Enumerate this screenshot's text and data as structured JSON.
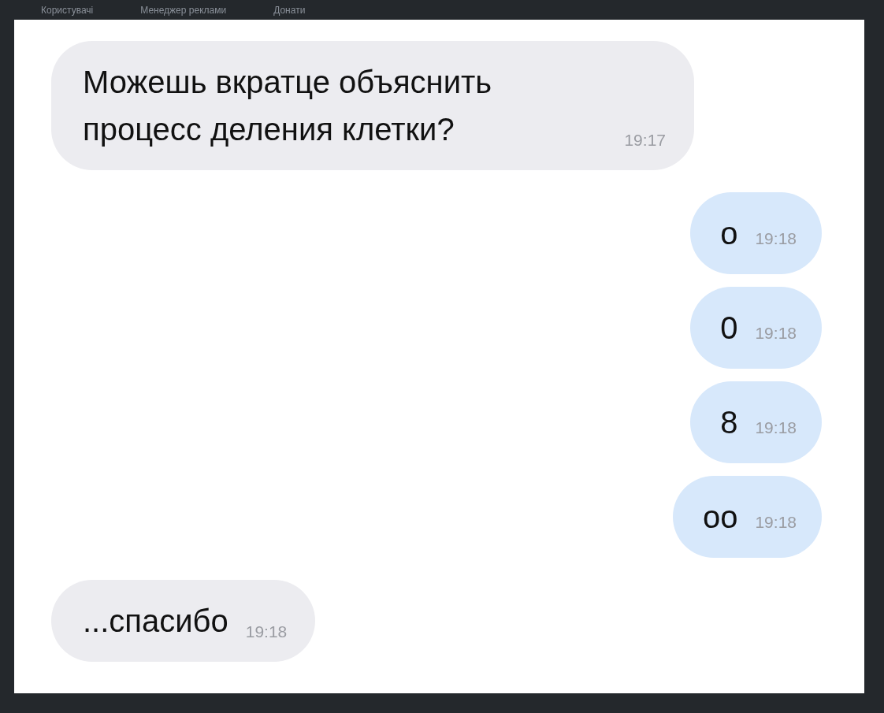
{
  "nav": [
    {
      "label": "Користувачі"
    },
    {
      "label": "Менеджер реклами"
    },
    {
      "label": "Донати"
    }
  ],
  "messages": [
    {
      "kind": "incoming",
      "text": "Можешь вкратце объяснить процесс деления клетки?",
      "time": "19:17"
    },
    {
      "kind": "outgoing",
      "text": "о",
      "time": "19:18"
    },
    {
      "kind": "outgoing",
      "text": "0",
      "time": "19:18"
    },
    {
      "kind": "outgoing",
      "text": "8",
      "time": "19:18"
    },
    {
      "kind": "outgoing",
      "text": "oo",
      "time": "19:18"
    },
    {
      "kind": "incoming",
      "text": "...спасибо",
      "time": "19:18"
    }
  ]
}
